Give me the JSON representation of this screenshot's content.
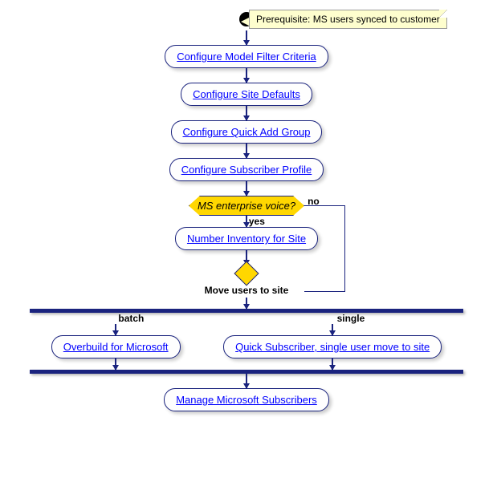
{
  "note": "Prerequisite: MS users synced to customer",
  "steps": {
    "s1": "Configure Model Filter Criteria",
    "s2": "Configure Site Defaults",
    "s3": "Configure Quick Add Group",
    "s4": "Configure Subscriber Profile",
    "decision": "MS enterprise voice?",
    "yes": "yes",
    "no": "no",
    "s5": "Number Inventory for Site",
    "forkTitle": "Move users to site",
    "batchLbl": "batch",
    "singleLbl": "single",
    "batch": "Overbuild for Microsoft",
    "single": "Quick Subscriber, single user move to site",
    "s6": "Manage Microsoft Subscribers"
  }
}
